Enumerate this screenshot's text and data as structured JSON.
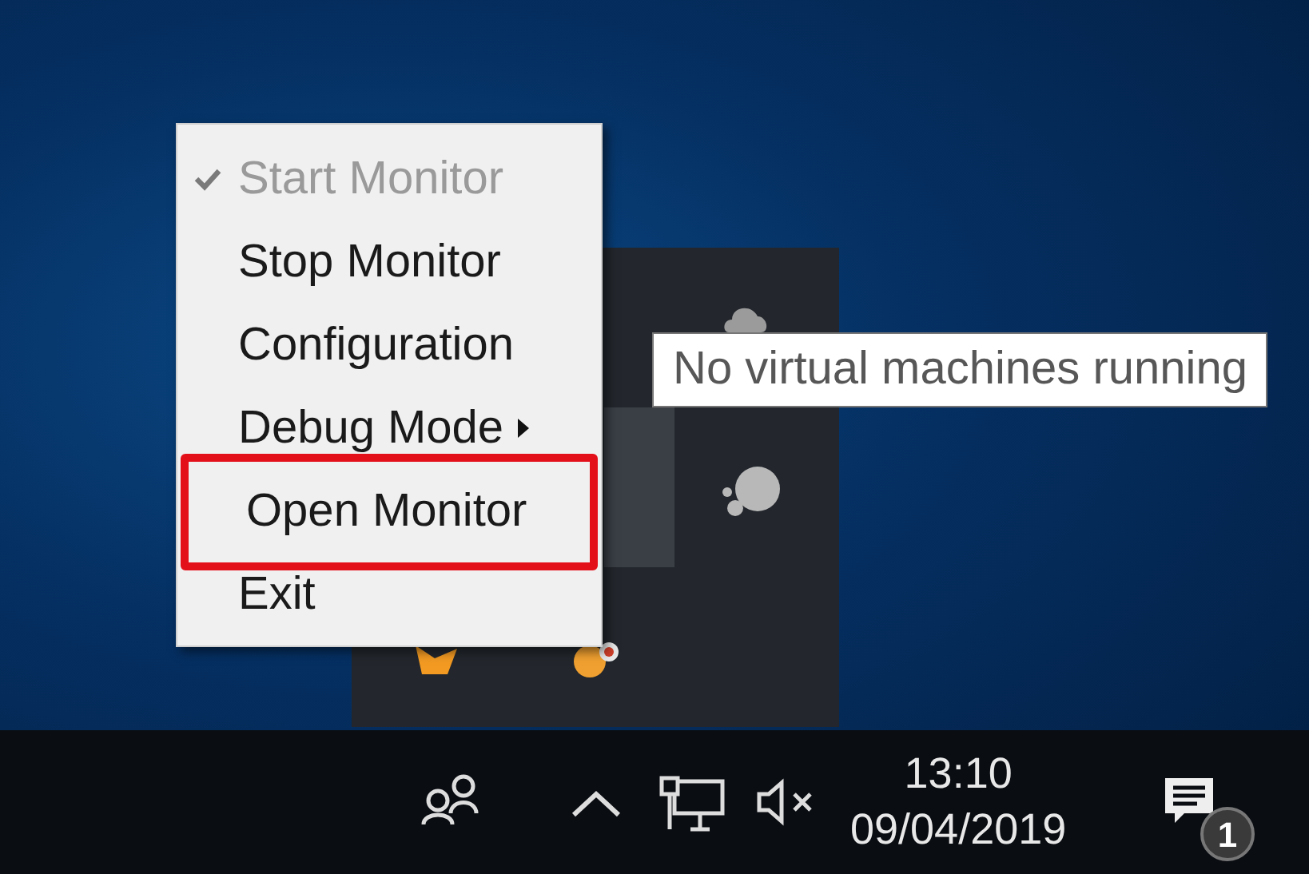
{
  "context_menu": {
    "items": [
      {
        "label": "Start Monitor",
        "checked": true,
        "disabled": true,
        "submenu": false,
        "marked": false
      },
      {
        "label": "Stop Monitor",
        "checked": false,
        "disabled": false,
        "submenu": false,
        "marked": false
      },
      {
        "label": "Configuration",
        "checked": false,
        "disabled": false,
        "submenu": false,
        "marked": false
      },
      {
        "label": "Debug Mode",
        "checked": false,
        "disabled": false,
        "submenu": true,
        "marked": false
      },
      {
        "label": "Open Monitor",
        "checked": false,
        "disabled": false,
        "submenu": false,
        "marked": true
      },
      {
        "label": "Exit",
        "checked": false,
        "disabled": false,
        "submenu": false,
        "marked": false
      }
    ]
  },
  "tooltip": {
    "text": "No virtual machines running"
  },
  "taskbar": {
    "clock": {
      "time": "13:10",
      "date": "09/04/2019"
    },
    "notifications": {
      "badge": "1"
    }
  }
}
